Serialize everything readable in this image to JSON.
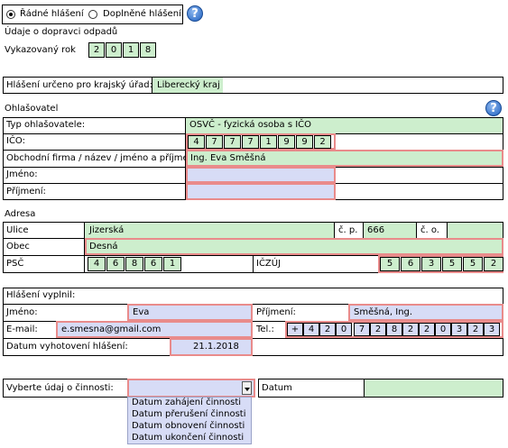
{
  "report_type": {
    "options": [
      "Řádné hlášení",
      "Doplněné hlášení"
    ],
    "selected": "Řádné hlášení"
  },
  "header": {
    "section_label": "Údaje o dopravci odpadů",
    "year_label": "Vykazovaný rok",
    "year_digits": [
      "2",
      "0",
      "1",
      "8"
    ]
  },
  "authority": {
    "label": "Hlášení určeno pro krajský úřad:",
    "value": "Liberecký kraj"
  },
  "declarant": {
    "section_label": "Ohlašovatel",
    "type_label": "Typ ohlašovatele:",
    "type_value": "OSVČ - fyzická osoba s IČO",
    "ico_label": "IČO:",
    "ico_digits": [
      "4",
      "7",
      "7",
      "7",
      "1",
      "9",
      "9",
      "2"
    ],
    "company_label": "Obchodní firma / název / jméno a příjmení:",
    "company_value": "Ing. Eva Směšná",
    "first_name_label": "Jméno:",
    "first_name_value": "",
    "last_name_label": "Příjmení:",
    "last_name_value": ""
  },
  "address": {
    "section_label": "Adresa",
    "street_label": "Ulice",
    "street_value": "Jizerská",
    "cp_label": "č. p.",
    "cp_value": "666",
    "co_label": "č. o.",
    "co_value": "",
    "city_label": "Obec",
    "city_value": "Desná",
    "psc_label": "PSČ",
    "psc_digits": [
      "4",
      "6",
      "8",
      "6",
      "1"
    ],
    "iczuj_label": "IČZÚJ",
    "iczuj_digits": [
      "5",
      "6",
      "3",
      "5",
      "5",
      "2"
    ]
  },
  "filled_by": {
    "section_label": "Hlášení vyplnil:",
    "first_name_label": "Jméno:",
    "first_name_value": "Eva",
    "last_name_label": "Příjmení:",
    "last_name_value": "Směšná, Ing.",
    "email_label": "E-mail:",
    "email_value": "e.smesna@gmail.com",
    "phone_label": "Tel.:",
    "phone_chars": [
      "+",
      "4",
      "2",
      "0",
      "7",
      "2",
      "8",
      "2",
      "2",
      "0",
      "3",
      "2",
      "3"
    ],
    "date_label": "Datum vyhotovení hlášení:",
    "date_value": "21.1.2018"
  },
  "activity": {
    "select_label": "Vyberte údaj o činnosti:",
    "select_value": "",
    "date_label": "Datum",
    "date_value": "",
    "options": [
      "Datum zahájení činnosti",
      "Datum přerušení činnosti",
      "Datum obnovení činnosti",
      "Datum ukončení činnosti"
    ]
  },
  "colors": {
    "field_green": "#cdeecd",
    "field_blue": "#d7dcf6",
    "required_border": "#e98b8b"
  },
  "icons": [
    "help-icon",
    "help-icon",
    "dropdown-arrow-icon"
  ]
}
